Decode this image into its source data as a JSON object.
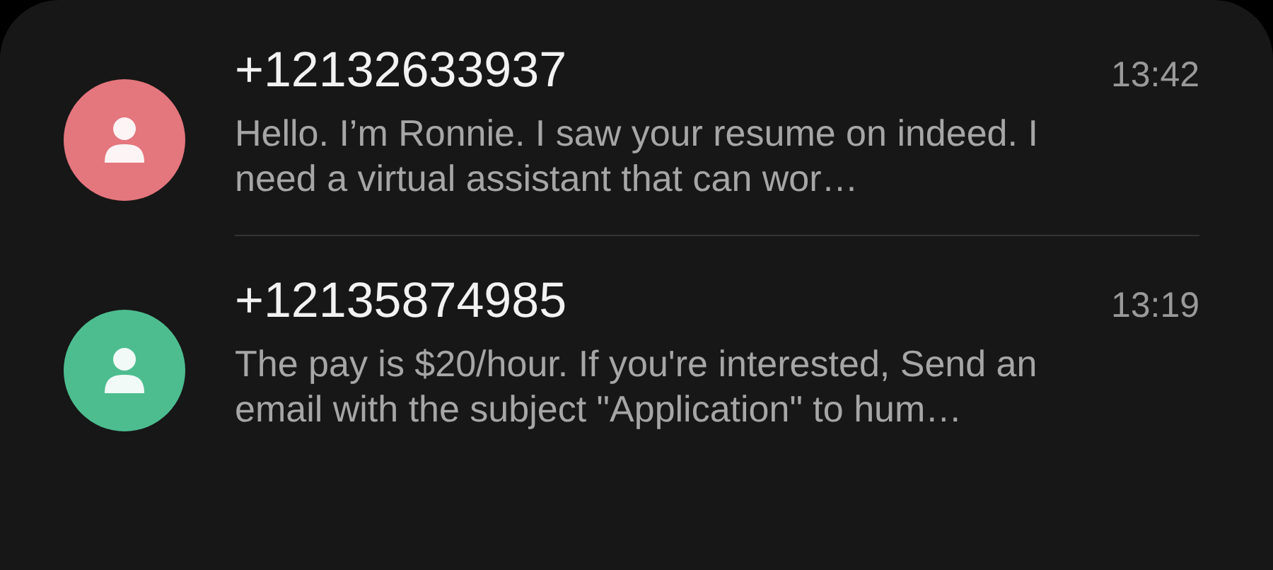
{
  "conversations": [
    {
      "sender": "+12132633937",
      "time": "13:42",
      "preview": "Hello. I’m Ronnie. I saw your resume on indeed. I need a virtual assistant that can wor…",
      "color": "#e4767d"
    },
    {
      "sender": "+12135874985",
      "time": "13:19",
      "preview": "The pay is $20/hour. If you're interested, Send an email with the subject \"Application\" to hum…",
      "color": "#4dbd90"
    }
  ]
}
